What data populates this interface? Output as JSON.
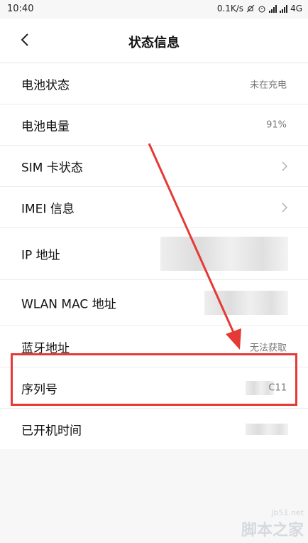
{
  "status_bar": {
    "time": "10:40",
    "net_speed": "0.1K/s",
    "network": "4G"
  },
  "header": {
    "title": "状态信息"
  },
  "rows": [
    {
      "label": "电池状态",
      "value": "未在充电"
    },
    {
      "label": "电池电量",
      "value": "91%"
    },
    {
      "label": "SIM 卡状态",
      "value": ""
    },
    {
      "label": "IMEI 信息",
      "value": ""
    },
    {
      "label": "IP 地址",
      "value": ""
    },
    {
      "label": "WLAN MAC 地址",
      "value": ""
    },
    {
      "label": "蓝牙地址",
      "value": "无法获取"
    },
    {
      "label": "序列号",
      "value": "C11"
    },
    {
      "label": "已开机时间",
      "value": ""
    }
  ],
  "watermark": {
    "line1": "jb51.net",
    "line2": "脚本之家"
  },
  "colors": {
    "annotation": "#e53935",
    "background": "#f7f7f7"
  }
}
